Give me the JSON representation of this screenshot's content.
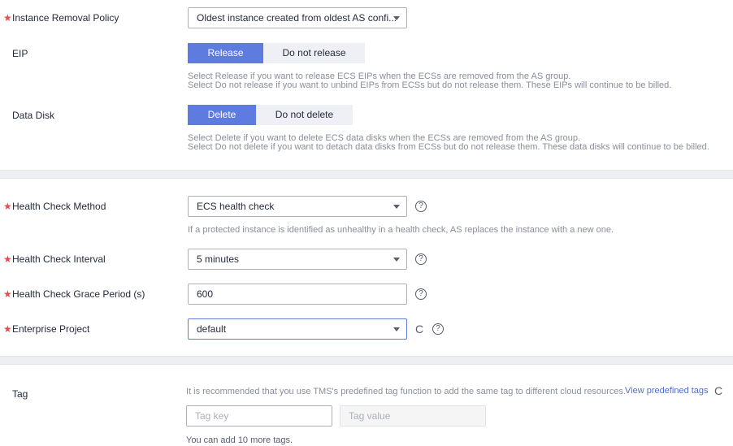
{
  "instance_removal": {
    "label": "Instance Removal Policy",
    "required": true,
    "value": "Oldest instance created from oldest AS confi..."
  },
  "eip": {
    "label": "EIP",
    "options": [
      "Release",
      "Do not release"
    ],
    "selected": "Release",
    "hint_line1": "Select Release if you want to release ECS EIPs when the ECSs are removed from the AS group.",
    "hint_line2": "Select Do not release if you want to unbind EIPs from ECSs but do not release them. These EIPs will continue to be billed."
  },
  "data_disk": {
    "label": "Data Disk",
    "options": [
      "Delete",
      "Do not delete"
    ],
    "selected": "Delete",
    "hint_line1": "Select Delete if you want to delete ECS data disks when the ECSs are removed from the AS group.",
    "hint_line2": "Select Do not delete if you want to detach data disks from ECSs but do not release them. These data disks will continue to be billed."
  },
  "health_check_method": {
    "label": "Health Check Method",
    "required": true,
    "value": "ECS health check",
    "hint": "If a protected instance is identified as unhealthy in a health check, AS replaces the instance with a new one."
  },
  "health_check_interval": {
    "label": "Health Check Interval",
    "required": true,
    "value": "5 minutes"
  },
  "grace_period": {
    "label": "Health Check Grace Period (s)",
    "required": true,
    "value": "600"
  },
  "enterprise_project": {
    "label": "Enterprise Project",
    "required": true,
    "value": "default"
  },
  "tag": {
    "label": "Tag",
    "recommendation": "It is recommended that you use TMS's predefined tag function to add the same tag to different cloud resources.",
    "view_link": "View predefined tags",
    "key_placeholder": "Tag key",
    "value_placeholder": "Tag value",
    "remaining": "You can add 10 more tags."
  },
  "icons": {
    "required": "★",
    "help": "?",
    "refresh": "C"
  },
  "colors": {
    "accent": "#5e7ce0",
    "required": "#e94a4a",
    "link": "#526ecc"
  }
}
